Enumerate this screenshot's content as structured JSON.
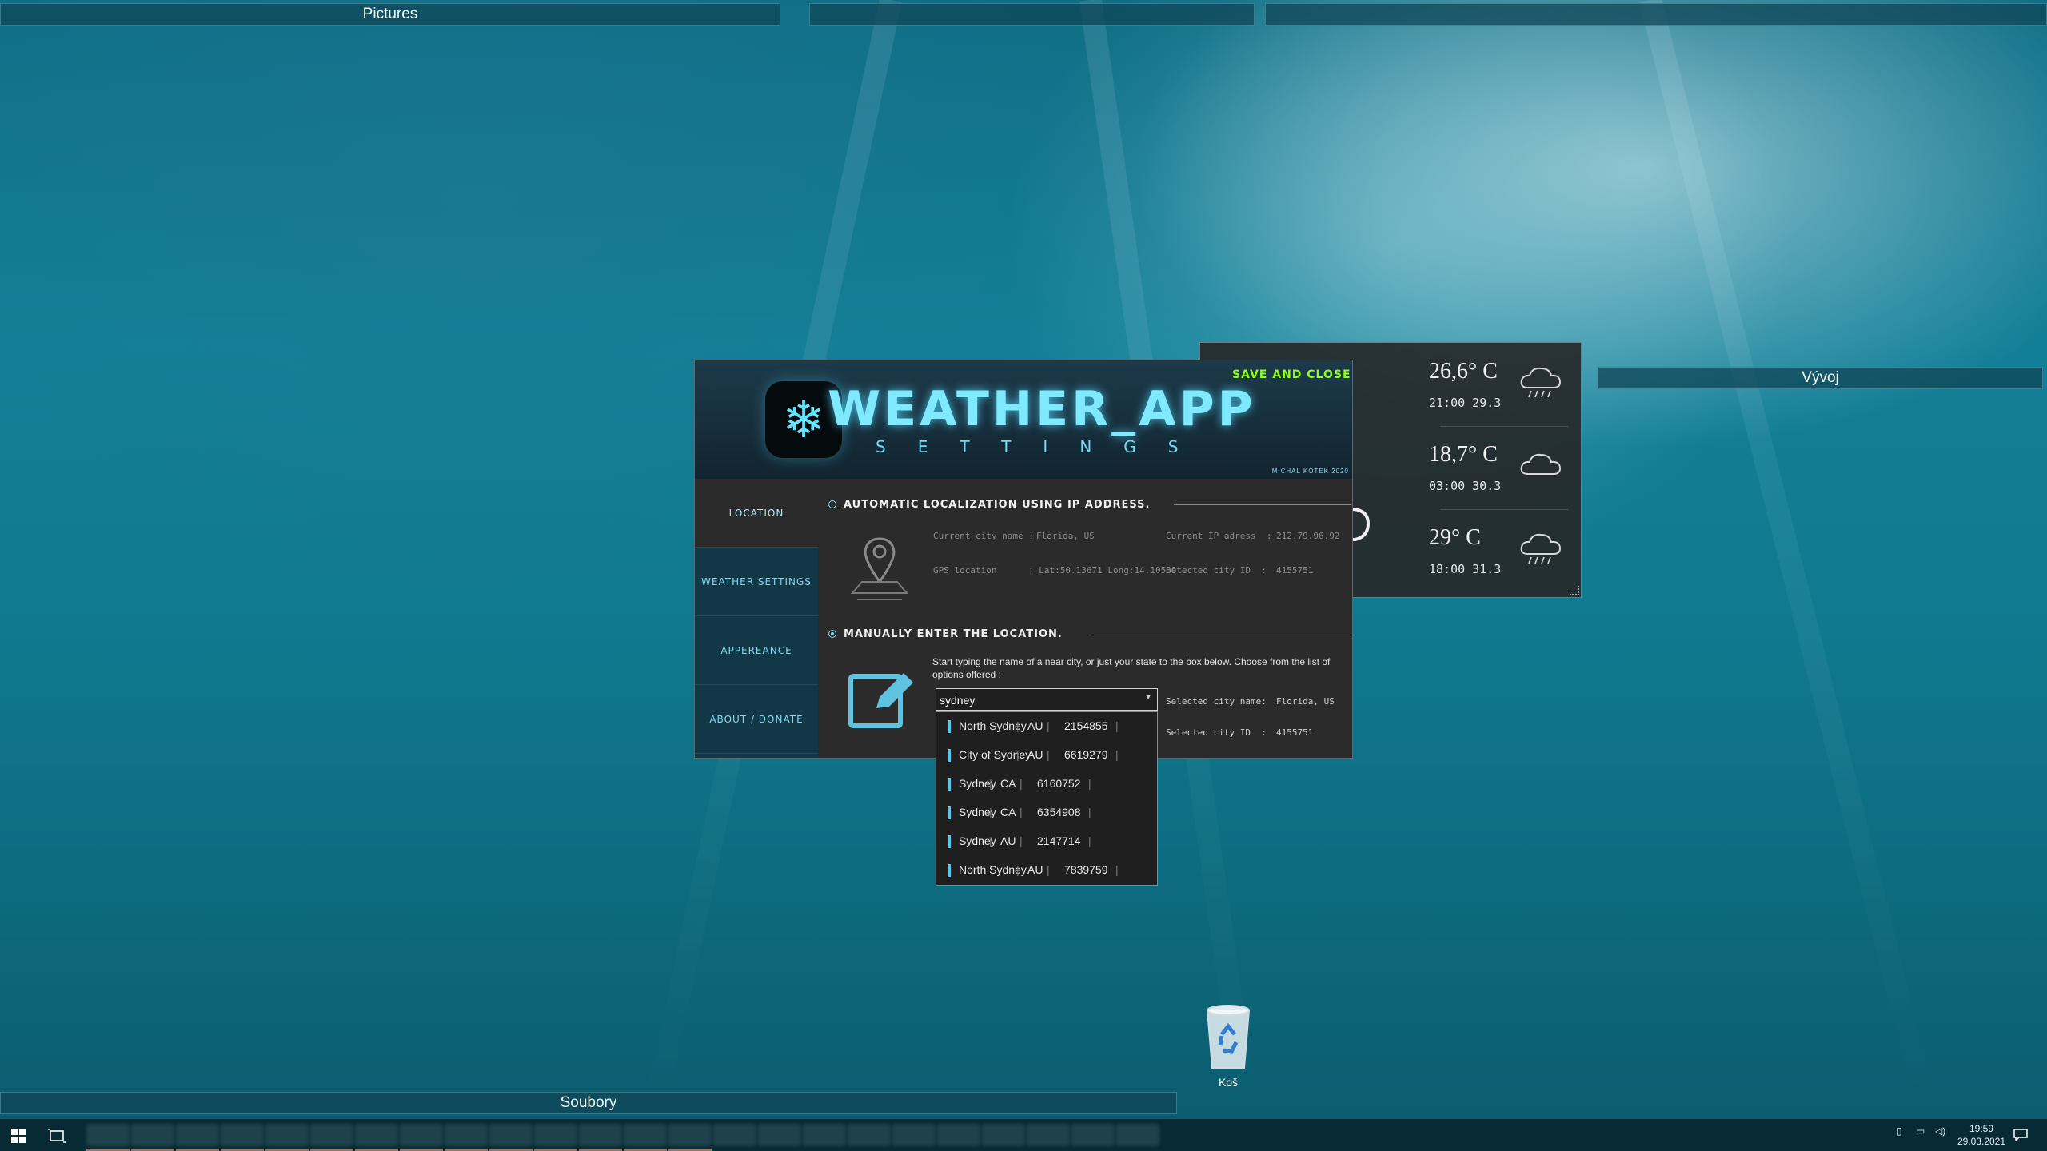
{
  "desktop": {
    "panels": {
      "top_left_label": "Pictures",
      "top_middle_label": "",
      "top_right_label": "",
      "right_label": "Vývoj",
      "bottom_label": "Soubory"
    },
    "recycle_bin_label": "Koš"
  },
  "settings": {
    "logo_title": "WEATHER_APP",
    "logo_subtitle": "SETTINGS",
    "save_close": "SAVE AND CLOSE",
    "author": "MICHAL KOTEK 2020",
    "nav": [
      {
        "label": "LOCATION",
        "active": true
      },
      {
        "label": "WEATHER SETTINGS",
        "active": false
      },
      {
        "label": "APPEREANCE",
        "active": false
      },
      {
        "label": "ABOUT / DONATE",
        "active": false
      }
    ],
    "auto": {
      "title": "AUTOMATIC LOCALIZATION USING IP ADDRESS.",
      "city_name_label": "Current city name :",
      "city_name_value": "Florida, US",
      "ip_label": "Current IP adress  :",
      "ip_value": "212.79.96.92",
      "gps_label": "GPS location",
      "gps_value": ": Lat:50.13671 Long:14.10589",
      "city_id_label": "Detected city ID  :",
      "city_id_value": "4155751"
    },
    "manual": {
      "title": "MANUALLY ENTER THE LOCATION.",
      "help": "Start typing the name of a near city, or just your state to the box below. Choose from the list of options offered :",
      "input_value": "sydney",
      "selected_name_label": "Selected city name:",
      "selected_name_value": "Florida, US",
      "selected_id_label": "Selected city ID  :",
      "selected_id_value": "4155751"
    },
    "options": [
      {
        "city": "North Sydney",
        "country": "AU",
        "id": "2154855"
      },
      {
        "city": "City of Sydney",
        "country": "AU",
        "id": "6619279"
      },
      {
        "city": "Sydney",
        "country": "CA",
        "id": "6160752"
      },
      {
        "city": "Sydney",
        "country": "CA",
        "id": "6354908"
      },
      {
        "city": "Sydney",
        "country": "AU",
        "id": "2147714"
      },
      {
        "city": "North Sydney",
        "country": "AU",
        "id": "7839759"
      }
    ],
    "separator": "|"
  },
  "widget": {
    "rows": [
      {
        "temp": "26,6° C",
        "time": "21:00 29.3",
        "icon": "rain-cloud-icon"
      },
      {
        "temp": "18,7° C",
        "time": "03:00 30.3",
        "icon": "cloud-icon"
      },
      {
        "temp": "29° C",
        "time": "18:00 31.3",
        "icon": "rain-cloud-icon"
      }
    ]
  },
  "taskbar": {
    "time": "19:59",
    "date": "29.03.2021"
  },
  "colors": {
    "accent_cyan": "#7fe9ff",
    "save_green": "#8cff1a",
    "sidebar": "#123746",
    "panel": "#2b2b2b"
  }
}
